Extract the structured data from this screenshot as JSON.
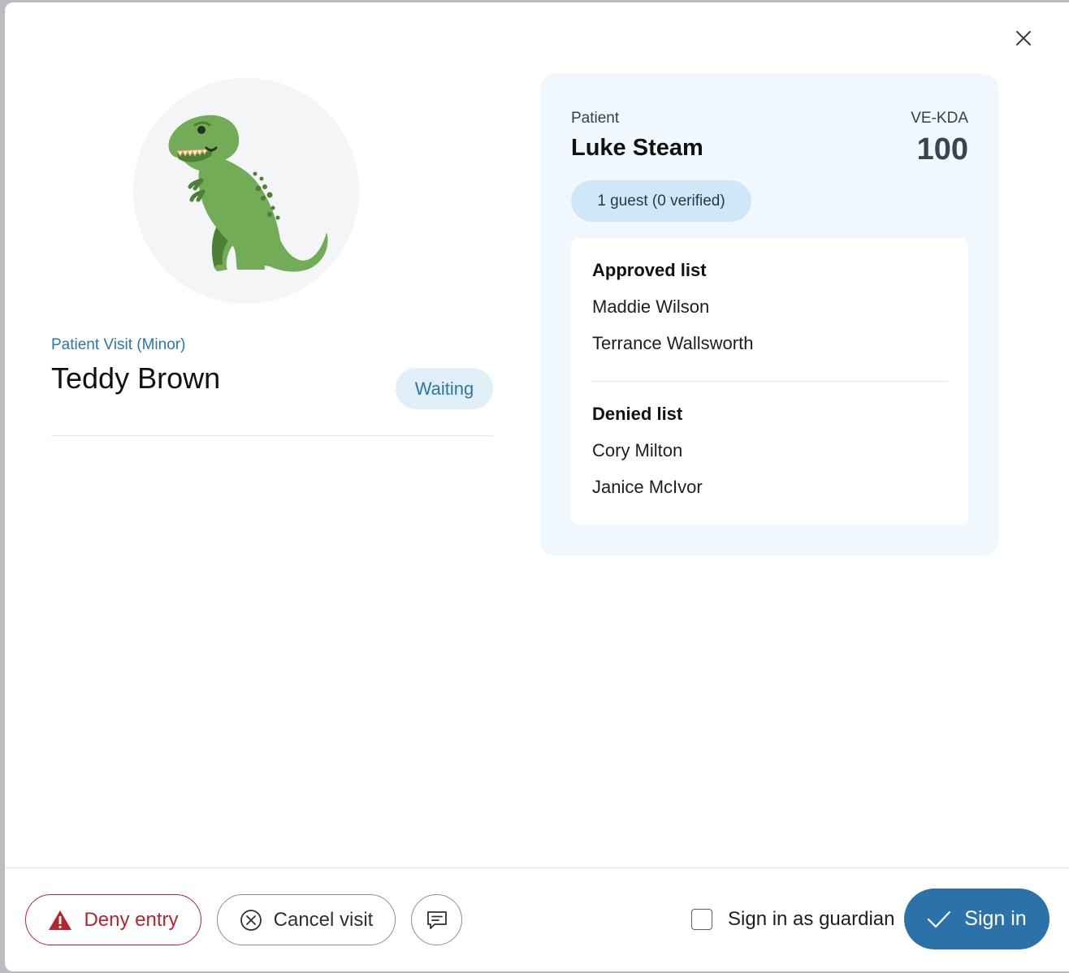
{
  "visit": {
    "type_label": "Patient Visit (Minor)",
    "visitor_name": "Teddy Brown",
    "status": "Waiting",
    "avatar_icon": "dinosaur-icon"
  },
  "patient": {
    "label": "Patient",
    "name": "Luke Steam",
    "unit_code": "VE-KDA",
    "room": "100",
    "guest_summary": "1 guest (0 verified)"
  },
  "lists": {
    "approved": {
      "heading": "Approved list",
      "names": [
        "Maddie Wilson",
        "Terrance Wallsworth"
      ]
    },
    "denied": {
      "heading": "Denied list",
      "names": [
        "Cory Milton",
        "Janice McIvor"
      ]
    }
  },
  "actions": {
    "deny_label": "Deny entry",
    "cancel_label": "Cancel visit",
    "message_icon": "message-icon",
    "guardian_label": "Sign in as guardian",
    "guardian_checked": false,
    "signin_label": "Sign in"
  },
  "colors": {
    "accent": "#2b72a8",
    "danger": "#b3262e",
    "card_background": "#f1f8fd",
    "badge_background": "#e1eff9"
  }
}
